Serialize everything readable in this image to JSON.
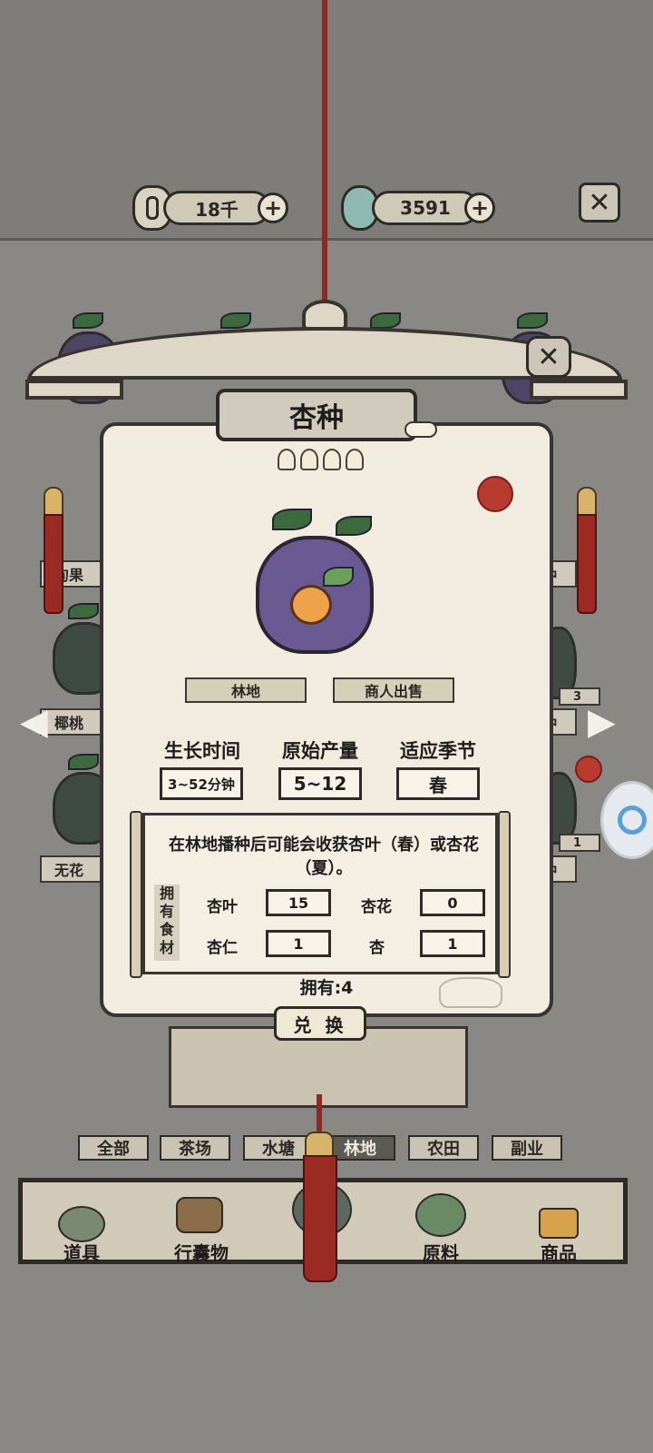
{
  "currency": {
    "coins": "18千",
    "jade": "3591"
  },
  "shelf_labels": {
    "left_1": "甸果",
    "left_2": "椰桃",
    "left_3": "无花",
    "right_1": "种",
    "right_2": "种",
    "right_3": "种",
    "right_count_1": "3",
    "right_count_2": "1"
  },
  "item": {
    "name": "杏种",
    "stars": 4,
    "tags": [
      "林地",
      "商人出售"
    ],
    "stats": [
      {
        "label": "生长时间",
        "value": "3~52分钟"
      },
      {
        "label": "原始产量",
        "value": "5~12"
      },
      {
        "label": "适应季节",
        "value": "春"
      }
    ],
    "description": "在林地播种后可能会收获杏叶（春）或杏花（夏）。",
    "ingredients_header": "拥有食材",
    "ingredients": [
      {
        "name": "杏叶",
        "count": "15"
      },
      {
        "name": "杏花",
        "count": "0"
      },
      {
        "name": "杏仁",
        "count": "1"
      },
      {
        "name": "杏",
        "count": "1"
      }
    ],
    "owned": "拥有:4",
    "exchange_label": "兑 换"
  },
  "filters": [
    {
      "label": "全部",
      "active": false
    },
    {
      "label": "茶场",
      "active": false
    },
    {
      "label": "水塘",
      "active": false
    },
    {
      "label": "林地",
      "active": true
    },
    {
      "label": "农田",
      "active": false
    },
    {
      "label": "副业",
      "active": false
    }
  ],
  "bottom_nav": [
    {
      "label": "道具",
      "icon": "pot-icon"
    },
    {
      "label": "行囊物",
      "icon": "robe-icon"
    },
    {
      "label": "",
      "icon": "seed-bag-icon"
    },
    {
      "label": "原料",
      "icon": "leaf-icon"
    },
    {
      "label": "商品",
      "icon": "box-icon"
    }
  ],
  "colors": {
    "background": "#8a8884",
    "panel": "#f1ecdf",
    "cord": "#8e2a24",
    "tassel": "#9a2a22"
  }
}
